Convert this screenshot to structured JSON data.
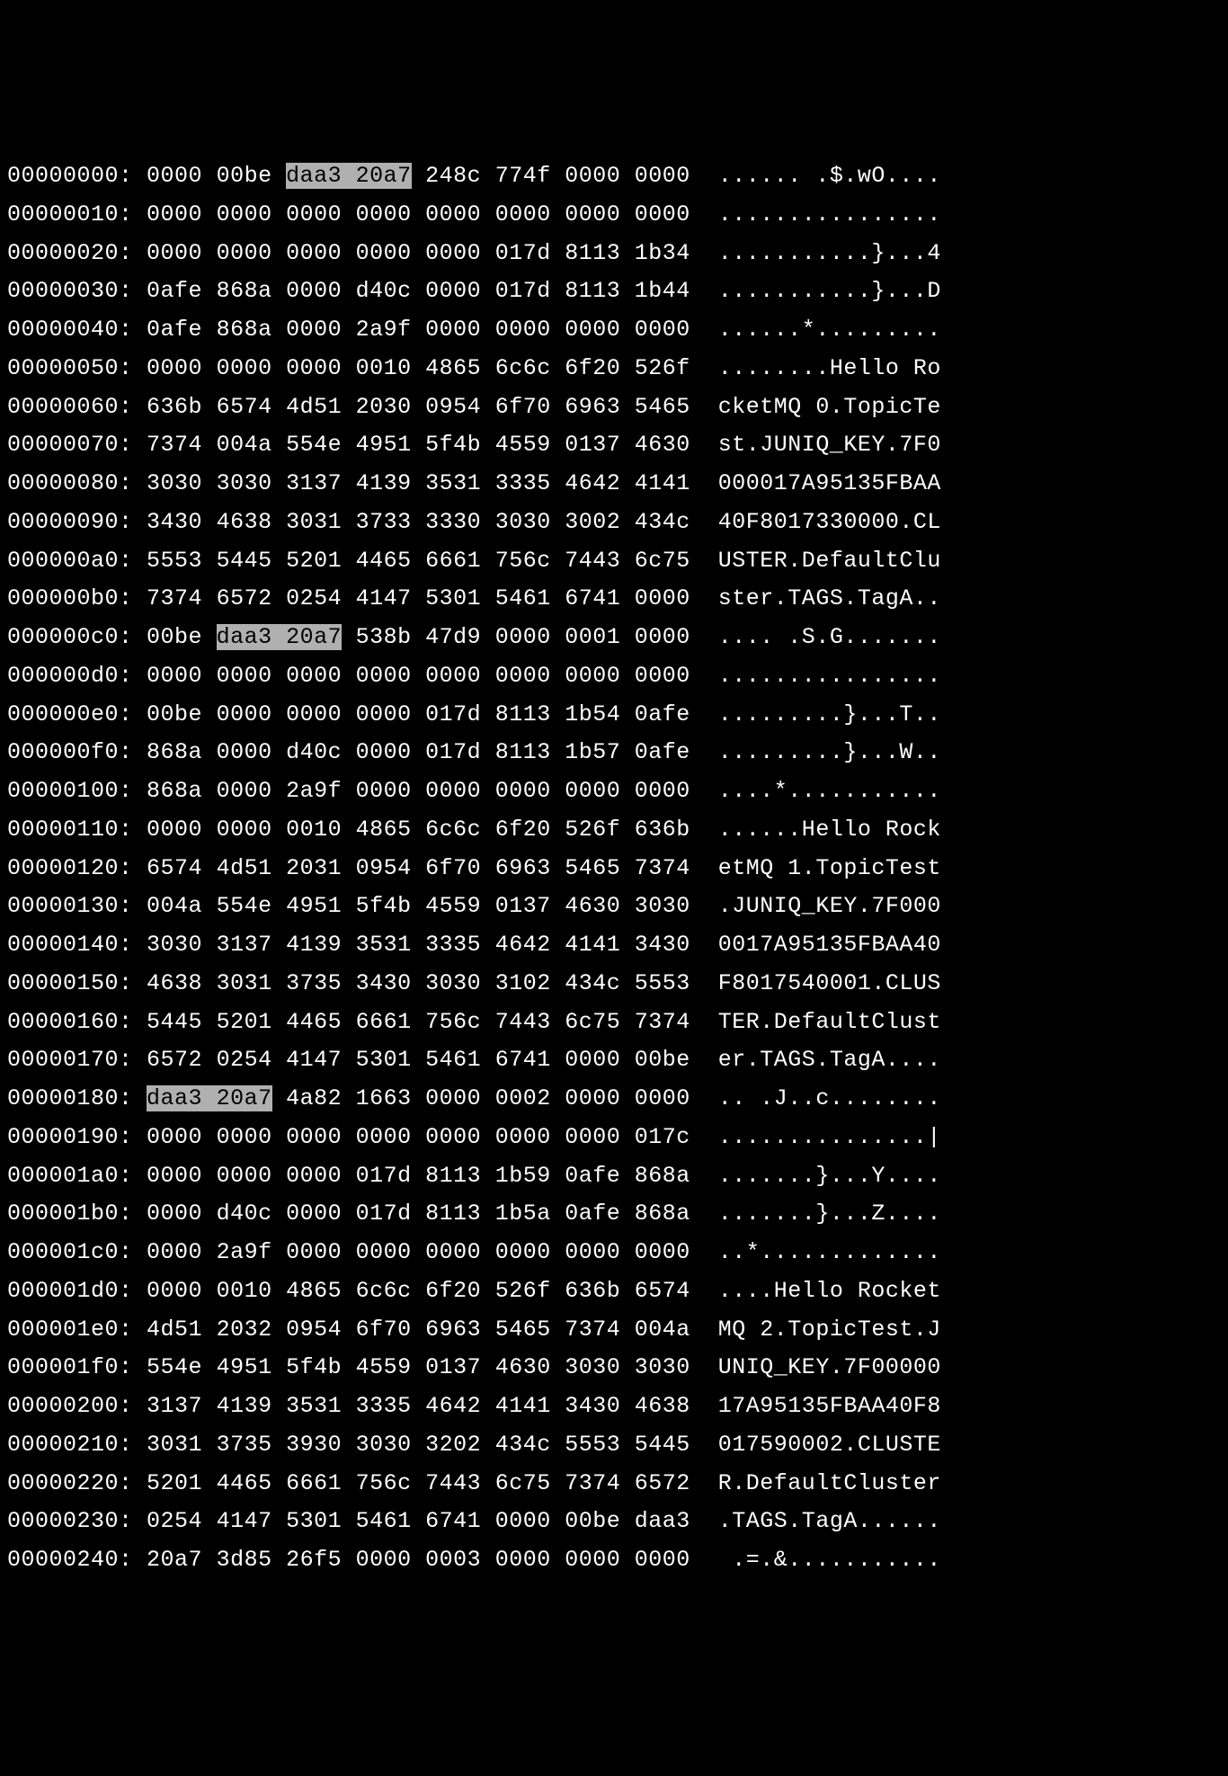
{
  "hexdump": {
    "rows": [
      {
        "offset": "00000000:",
        "hex_groups": [
          "0000",
          "00be",
          "daa3",
          "20a7",
          "248c",
          "774f",
          "0000",
          "0000"
        ],
        "highlight_indices": [
          2,
          3
        ],
        "ascii": "...... .$.wO...."
      },
      {
        "offset": "00000010:",
        "hex_groups": [
          "0000",
          "0000",
          "0000",
          "0000",
          "0000",
          "0000",
          "0000",
          "0000"
        ],
        "highlight_indices": [],
        "ascii": "................"
      },
      {
        "offset": "00000020:",
        "hex_groups": [
          "0000",
          "0000",
          "0000",
          "0000",
          "0000",
          "017d",
          "8113",
          "1b34"
        ],
        "highlight_indices": [],
        "ascii": "...........}...4"
      },
      {
        "offset": "00000030:",
        "hex_groups": [
          "0afe",
          "868a",
          "0000",
          "d40c",
          "0000",
          "017d",
          "8113",
          "1b44"
        ],
        "highlight_indices": [],
        "ascii": "...........}...D"
      },
      {
        "offset": "00000040:",
        "hex_groups": [
          "0afe",
          "868a",
          "0000",
          "2a9f",
          "0000",
          "0000",
          "0000",
          "0000"
        ],
        "highlight_indices": [],
        "ascii": "......*........."
      },
      {
        "offset": "00000050:",
        "hex_groups": [
          "0000",
          "0000",
          "0000",
          "0010",
          "4865",
          "6c6c",
          "6f20",
          "526f"
        ],
        "highlight_indices": [],
        "ascii": "........Hello Ro"
      },
      {
        "offset": "00000060:",
        "hex_groups": [
          "636b",
          "6574",
          "4d51",
          "2030",
          "0954",
          "6f70",
          "6963",
          "5465"
        ],
        "highlight_indices": [],
        "ascii": "cketMQ 0.TopicTe"
      },
      {
        "offset": "00000070:",
        "hex_groups": [
          "7374",
          "004a",
          "554e",
          "4951",
          "5f4b",
          "4559",
          "0137",
          "4630"
        ],
        "highlight_indices": [],
        "ascii": "st.JUNIQ_KEY.7F0"
      },
      {
        "offset": "00000080:",
        "hex_groups": [
          "3030",
          "3030",
          "3137",
          "4139",
          "3531",
          "3335",
          "4642",
          "4141"
        ],
        "highlight_indices": [],
        "ascii": "000017A95135FBAA"
      },
      {
        "offset": "00000090:",
        "hex_groups": [
          "3430",
          "4638",
          "3031",
          "3733",
          "3330",
          "3030",
          "3002",
          "434c"
        ],
        "highlight_indices": [],
        "ascii": "40F8017330000.CL"
      },
      {
        "offset": "000000a0:",
        "hex_groups": [
          "5553",
          "5445",
          "5201",
          "4465",
          "6661",
          "756c",
          "7443",
          "6c75"
        ],
        "highlight_indices": [],
        "ascii": "USTER.DefaultClu"
      },
      {
        "offset": "000000b0:",
        "hex_groups": [
          "7374",
          "6572",
          "0254",
          "4147",
          "5301",
          "5461",
          "6741",
          "0000"
        ],
        "highlight_indices": [],
        "ascii": "ster.TAGS.TagA.."
      },
      {
        "offset": "000000c0:",
        "hex_groups": [
          "00be",
          "daa3",
          "20a7",
          "538b",
          "47d9",
          "0000",
          "0001",
          "0000"
        ],
        "highlight_indices": [
          1,
          2
        ],
        "ascii": ".... .S.G......."
      },
      {
        "offset": "000000d0:",
        "hex_groups": [
          "0000",
          "0000",
          "0000",
          "0000",
          "0000",
          "0000",
          "0000",
          "0000"
        ],
        "highlight_indices": [],
        "ascii": "................"
      },
      {
        "offset": "000000e0:",
        "hex_groups": [
          "00be",
          "0000",
          "0000",
          "0000",
          "017d",
          "8113",
          "1b54",
          "0afe"
        ],
        "highlight_indices": [],
        "ascii": ".........}...T.."
      },
      {
        "offset": "000000f0:",
        "hex_groups": [
          "868a",
          "0000",
          "d40c",
          "0000",
          "017d",
          "8113",
          "1b57",
          "0afe"
        ],
        "highlight_indices": [],
        "ascii": ".........}...W.."
      },
      {
        "offset": "00000100:",
        "hex_groups": [
          "868a",
          "0000",
          "2a9f",
          "0000",
          "0000",
          "0000",
          "0000",
          "0000"
        ],
        "highlight_indices": [],
        "ascii": "....*..........."
      },
      {
        "offset": "00000110:",
        "hex_groups": [
          "0000",
          "0000",
          "0010",
          "4865",
          "6c6c",
          "6f20",
          "526f",
          "636b"
        ],
        "highlight_indices": [],
        "ascii": "......Hello Rock"
      },
      {
        "offset": "00000120:",
        "hex_groups": [
          "6574",
          "4d51",
          "2031",
          "0954",
          "6f70",
          "6963",
          "5465",
          "7374"
        ],
        "highlight_indices": [],
        "ascii": "etMQ 1.TopicTest"
      },
      {
        "offset": "00000130:",
        "hex_groups": [
          "004a",
          "554e",
          "4951",
          "5f4b",
          "4559",
          "0137",
          "4630",
          "3030"
        ],
        "highlight_indices": [],
        "ascii": ".JUNIQ_KEY.7F000"
      },
      {
        "offset": "00000140:",
        "hex_groups": [
          "3030",
          "3137",
          "4139",
          "3531",
          "3335",
          "4642",
          "4141",
          "3430"
        ],
        "highlight_indices": [],
        "ascii": "0017A95135FBAA40"
      },
      {
        "offset": "00000150:",
        "hex_groups": [
          "4638",
          "3031",
          "3735",
          "3430",
          "3030",
          "3102",
          "434c",
          "5553"
        ],
        "highlight_indices": [],
        "ascii": "F8017540001.CLUS"
      },
      {
        "offset": "00000160:",
        "hex_groups": [
          "5445",
          "5201",
          "4465",
          "6661",
          "756c",
          "7443",
          "6c75",
          "7374"
        ],
        "highlight_indices": [],
        "ascii": "TER.DefaultClust"
      },
      {
        "offset": "00000170:",
        "hex_groups": [
          "6572",
          "0254",
          "4147",
          "5301",
          "5461",
          "6741",
          "0000",
          "00be"
        ],
        "highlight_indices": [],
        "ascii": "er.TAGS.TagA...."
      },
      {
        "offset": "00000180:",
        "hex_groups": [
          "daa3",
          "20a7",
          "4a82",
          "1663",
          "0000",
          "0002",
          "0000",
          "0000"
        ],
        "highlight_indices": [
          0,
          1
        ],
        "ascii": ".. .J..c........"
      },
      {
        "offset": "00000190:",
        "hex_groups": [
          "0000",
          "0000",
          "0000",
          "0000",
          "0000",
          "0000",
          "0000",
          "017c"
        ],
        "highlight_indices": [],
        "ascii": "...............|"
      },
      {
        "offset": "000001a0:",
        "hex_groups": [
          "0000",
          "0000",
          "0000",
          "017d",
          "8113",
          "1b59",
          "0afe",
          "868a"
        ],
        "highlight_indices": [],
        "ascii": ".......}...Y...."
      },
      {
        "offset": "000001b0:",
        "hex_groups": [
          "0000",
          "d40c",
          "0000",
          "017d",
          "8113",
          "1b5a",
          "0afe",
          "868a"
        ],
        "highlight_indices": [],
        "ascii": ".......}...Z...."
      },
      {
        "offset": "000001c0:",
        "hex_groups": [
          "0000",
          "2a9f",
          "0000",
          "0000",
          "0000",
          "0000",
          "0000",
          "0000"
        ],
        "highlight_indices": [],
        "ascii": "..*............."
      },
      {
        "offset": "000001d0:",
        "hex_groups": [
          "0000",
          "0010",
          "4865",
          "6c6c",
          "6f20",
          "526f",
          "636b",
          "6574"
        ],
        "highlight_indices": [],
        "ascii": "....Hello Rocket"
      },
      {
        "offset": "000001e0:",
        "hex_groups": [
          "4d51",
          "2032",
          "0954",
          "6f70",
          "6963",
          "5465",
          "7374",
          "004a"
        ],
        "highlight_indices": [],
        "ascii": "MQ 2.TopicTest.J"
      },
      {
        "offset": "000001f0:",
        "hex_groups": [
          "554e",
          "4951",
          "5f4b",
          "4559",
          "0137",
          "4630",
          "3030",
          "3030"
        ],
        "highlight_indices": [],
        "ascii": "UNIQ_KEY.7F00000"
      },
      {
        "offset": "00000200:",
        "hex_groups": [
          "3137",
          "4139",
          "3531",
          "3335",
          "4642",
          "4141",
          "3430",
          "4638"
        ],
        "highlight_indices": [],
        "ascii": "17A95135FBAA40F8"
      },
      {
        "offset": "00000210:",
        "hex_groups": [
          "3031",
          "3735",
          "3930",
          "3030",
          "3202",
          "434c",
          "5553",
          "5445"
        ],
        "highlight_indices": [],
        "ascii": "017590002.CLUSTE"
      },
      {
        "offset": "00000220:",
        "hex_groups": [
          "5201",
          "4465",
          "6661",
          "756c",
          "7443",
          "6c75",
          "7374",
          "6572"
        ],
        "highlight_indices": [],
        "ascii": "R.DefaultCluster"
      },
      {
        "offset": "00000230:",
        "hex_groups": [
          "0254",
          "4147",
          "5301",
          "5461",
          "6741",
          "0000",
          "00be",
          "daa3"
        ],
        "highlight_indices": [],
        "ascii": ".TAGS.TagA......"
      },
      {
        "offset": "00000240:",
        "hex_groups": [
          "20a7",
          "3d85",
          "26f5",
          "0000",
          "0003",
          "0000",
          "0000",
          "0000"
        ],
        "highlight_indices": [],
        "ascii": " .=.&..........."
      }
    ]
  }
}
